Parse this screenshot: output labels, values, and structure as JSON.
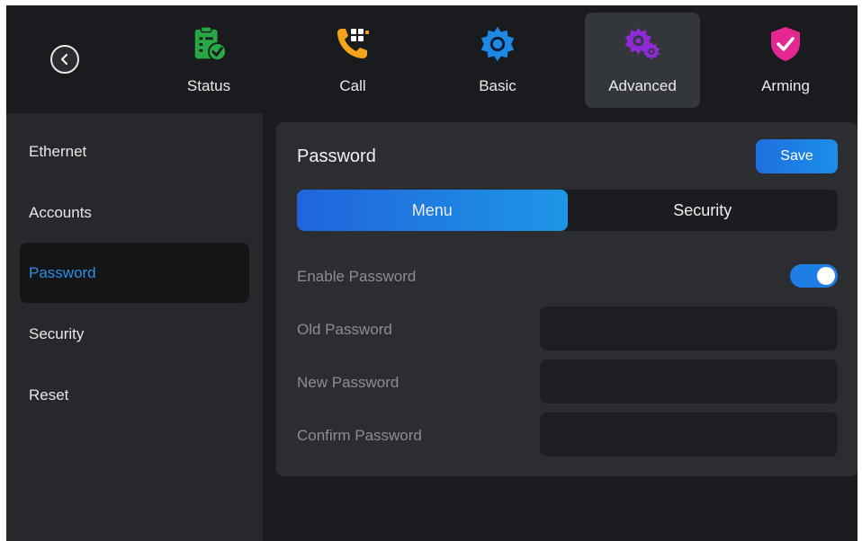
{
  "nav": {
    "back_icon": "chevron-left-icon",
    "tabs": [
      {
        "label": "Status",
        "icon": "clipboard-check-icon",
        "color": "#27a844"
      },
      {
        "label": "Call",
        "icon": "phone-keypad-icon",
        "color": "#f2a51a"
      },
      {
        "label": "Basic",
        "icon": "gear-icon",
        "color": "#1e88e5"
      },
      {
        "label": "Advanced",
        "icon": "gears-icon",
        "color": "#8e2bd6",
        "active": true
      },
      {
        "label": "Arming",
        "icon": "shield-check-icon",
        "color": "#e52891"
      }
    ]
  },
  "sidebar": {
    "items": [
      {
        "label": "Ethernet"
      },
      {
        "label": "Accounts"
      },
      {
        "label": "Password",
        "active": true
      },
      {
        "label": "Security"
      },
      {
        "label": "Reset"
      }
    ]
  },
  "panel": {
    "title": "Password",
    "save_label": "Save",
    "segments": [
      {
        "label": "Menu",
        "active": true
      },
      {
        "label": "Security"
      }
    ],
    "enable_password": {
      "label": "Enable Password",
      "value": true
    },
    "old_password": {
      "label": "Old Password",
      "value": ""
    },
    "new_password": {
      "label": "New Password",
      "value": ""
    },
    "confirm_password": {
      "label": "Confirm Password",
      "value": ""
    }
  },
  "colors": {
    "accent": "#1e7ee6",
    "active_sidebar_text": "#2d8fe6",
    "background": "#1a1c1f"
  }
}
